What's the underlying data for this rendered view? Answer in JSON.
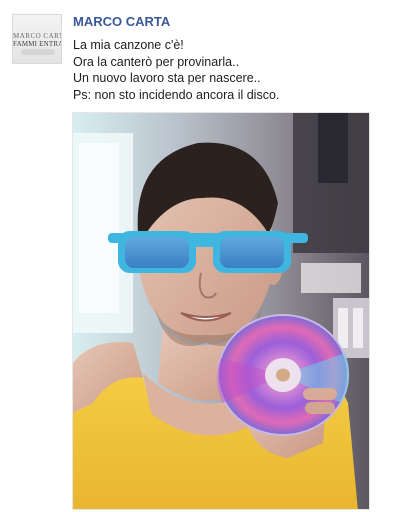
{
  "post": {
    "author": "MARCO CARTA",
    "avatar": {
      "line1": "MARCO CARTA",
      "line2": "FAMMI ENTRARE"
    },
    "message_lines": [
      "La mia canzone c'è!",
      "Ora la canterò per provinarla..",
      "Un nuovo lavoro sta per nascere..",
      "Ps: non sto incidendo ancora il disco."
    ]
  },
  "colors": {
    "author_link": "#3b5998",
    "text": "#1c1e21",
    "sunglasses": "#3fb6e0",
    "tank_top": "#f2c23a"
  }
}
